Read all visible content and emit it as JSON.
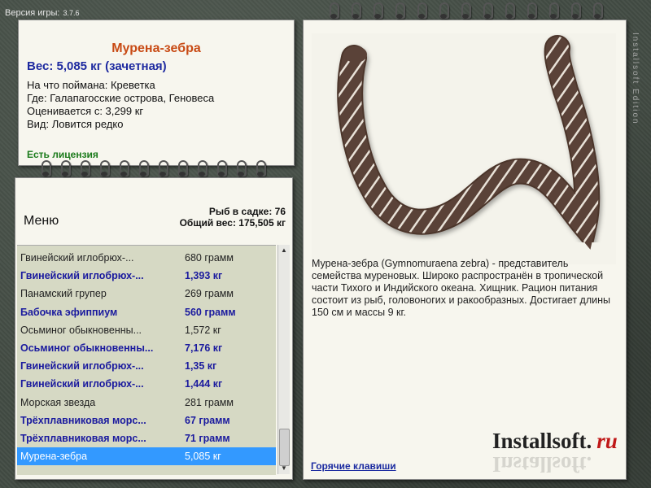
{
  "app": {
    "version_label": "Версия игры:",
    "version_number": "3.7.6",
    "side_text": "Installsoft Edition"
  },
  "info": {
    "fish_name": "Мурена-зебра",
    "weight": "Вес: 5,085 кг (зачетная)",
    "caught_on": "На что поймана: Креветка",
    "location": "Где: Галапагосские острова, Геновеса",
    "min_rated": "Оценивается с: 3,299 кг",
    "rarity": "Вид: Ловится редко",
    "license": "Есть лицензия"
  },
  "list_panel": {
    "menu_label": "Меню",
    "fish_in_cage": "Рыб в садке: 76",
    "total_weight": "Общий вес: 175,505 кг",
    "rows": [
      {
        "name": "Гвинейский иглобрюх-...",
        "weight": "680 грамм",
        "bold": false,
        "selected": false
      },
      {
        "name": "Гвинейский иглобрюх-...",
        "weight": "1,393 кг",
        "bold": true,
        "selected": false
      },
      {
        "name": "Панамский групер",
        "weight": "269 грамм",
        "bold": false,
        "selected": false
      },
      {
        "name": "Бабочка эфиппиум",
        "weight": "560 грамм",
        "bold": true,
        "selected": false
      },
      {
        "name": "Осьминог обыкновенны...",
        "weight": "1,572 кг",
        "bold": false,
        "selected": false
      },
      {
        "name": "Осьминог обыкновенны...",
        "weight": "7,176 кг",
        "bold": true,
        "selected": false
      },
      {
        "name": "Гвинейский иглобрюх-...",
        "weight": "1,35 кг",
        "bold": true,
        "selected": false
      },
      {
        "name": "Гвинейский иглобрюх-...",
        "weight": "1,444 кг",
        "bold": true,
        "selected": false
      },
      {
        "name": "Морская звезда",
        "weight": "281 грамм",
        "bold": false,
        "selected": false
      },
      {
        "name": "Трёхплавниковая морс...",
        "weight": "67 грамм",
        "bold": true,
        "selected": false
      },
      {
        "name": "Трёхплавниковая морс...",
        "weight": "71 грамм",
        "bold": true,
        "selected": false
      },
      {
        "name": "Мурена-зебра",
        "weight": "5,085 кг",
        "bold": false,
        "selected": true
      }
    ]
  },
  "detail": {
    "description": "Мурена-зебра (Gymnomuraena zebra) - представитель семейства муреновых. Широко распространён в тропической части Тихого и Индийского океана. Хищник. Рацион питания состоит из рыб, головоногих и ракообразных. Достигает длины 150 см и массы 9 кг.",
    "hotkeys_link": "Горячие клавиши",
    "logo_main": "Installsoft.",
    "logo_suffix": "ru"
  },
  "colors": {
    "title": "#c84a14",
    "weight": "#1e2aa0",
    "license": "#1a7a1a",
    "selection": "#3399ff",
    "list_bg": "#d6d9c4"
  },
  "icons": [
    "spiral-ring-icon",
    "scroll-up-arrow-icon",
    "scroll-down-arrow-icon",
    "moray-eel-image"
  ]
}
